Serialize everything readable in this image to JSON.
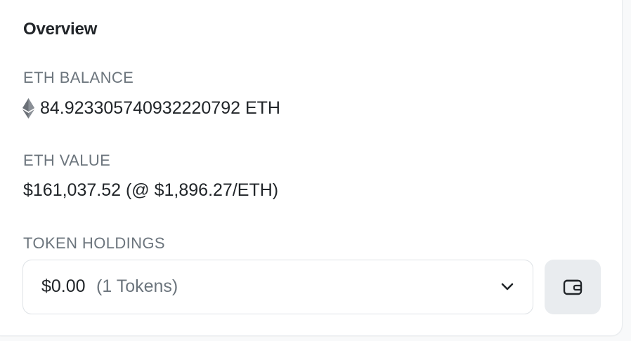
{
  "overview": {
    "title": "Overview",
    "eth_balance": {
      "label": "ETH BALANCE",
      "icon": "ethereum-icon",
      "value": "84.923305740932220792 ETH"
    },
    "eth_value": {
      "label": "ETH VALUE",
      "value": "$161,037.52 (@ $1,896.27/ETH)"
    },
    "token_holdings": {
      "label": "TOKEN HOLDINGS",
      "selected_amount": "$0.00",
      "selected_count": "(1 Tokens)",
      "dropdown_icon": "chevron-down-icon",
      "button_icon": "wallet-icon"
    }
  },
  "colors": {
    "text_primary": "#212529",
    "text_secondary": "#6c757d",
    "border": "#dee2e6",
    "button_bg": "#e9ecef"
  }
}
